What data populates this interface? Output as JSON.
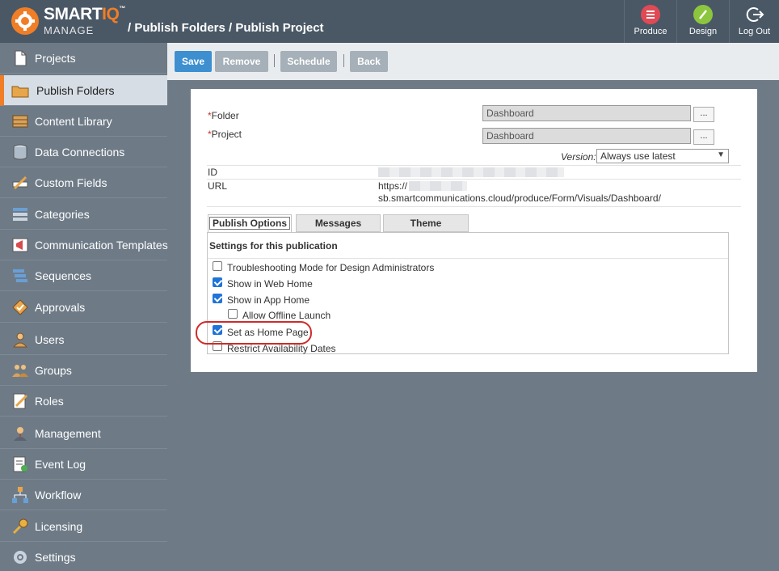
{
  "header": {
    "logo_main": "SMART",
    "logo_accent": "IQ",
    "logo_tm": "™",
    "logo_sub": "MANAGE",
    "breadcrumb": "/ Publish Folders / Publish Project",
    "buttons": [
      {
        "label": "Produce",
        "icon": "produce-icon",
        "color": "#e04a55"
      },
      {
        "label": "Design",
        "icon": "pencil-icon",
        "color": "#8cc63f"
      },
      {
        "label": "Log Out",
        "icon": "logout-icon",
        "color": "#ffffff"
      }
    ]
  },
  "sidebar": {
    "items": [
      {
        "label": "Projects",
        "icon": "document-icon"
      },
      {
        "label": "Publish Folders",
        "icon": "folder-icon",
        "active": true
      },
      {
        "label": "Content Library",
        "icon": "library-icon"
      },
      {
        "label": "Data Connections",
        "icon": "database-icon"
      },
      {
        "label": "Custom Fields",
        "icon": "custom-fields-icon"
      },
      {
        "label": "Categories",
        "icon": "categories-icon"
      },
      {
        "label": "Communication Templates",
        "icon": "communication-icon"
      },
      {
        "label": "Sequences",
        "icon": "sequences-icon"
      },
      {
        "label": "Approvals",
        "icon": "approvals-icon"
      },
      {
        "label": "Users",
        "icon": "user-icon"
      },
      {
        "label": "Groups",
        "icon": "groups-icon"
      },
      {
        "label": "Roles",
        "icon": "roles-icon"
      },
      {
        "label": "Management",
        "icon": "management-icon"
      },
      {
        "label": "Event Log",
        "icon": "event-log-icon"
      },
      {
        "label": "Workflow",
        "icon": "workflow-icon"
      },
      {
        "label": "Licensing",
        "icon": "key-icon"
      },
      {
        "label": "Settings",
        "icon": "gear-icon"
      }
    ]
  },
  "toolbar": {
    "save": "Save",
    "remove": "Remove",
    "schedule": "Schedule",
    "back": "Back"
  },
  "form": {
    "required_mark": "*",
    "folder_label": "Folder",
    "folder_value": "Dashboard",
    "project_label": "Project",
    "project_value": "Dashboard",
    "browse": "...",
    "version_label": "Version:",
    "version_value": "Always use latest",
    "id_label": "ID",
    "url_label": "URL",
    "url_line1": "https://",
    "url_line2": "sb.smartcommunications.cloud/produce/Form/Visuals/Dashboard/"
  },
  "tabs": [
    {
      "label": "Publish Options",
      "active": true
    },
    {
      "label": "Messages"
    },
    {
      "label": "Theme"
    }
  ],
  "settings": {
    "title": "Settings for this publication",
    "options": [
      {
        "label": "Troubleshooting Mode for Design Administrators",
        "checked": false
      },
      {
        "label": "Show in Web Home",
        "checked": true
      },
      {
        "label": "Show in App Home",
        "checked": true
      },
      {
        "label": "Allow Offline Launch",
        "checked": false
      },
      {
        "label": "Set as Home Page",
        "checked": true
      },
      {
        "label": "Restrict Availability Dates",
        "checked": false
      }
    ]
  },
  "colors": {
    "accent": "#f07e26",
    "primary_button": "#3d8fd0",
    "highlight": "#d02a2a"
  }
}
